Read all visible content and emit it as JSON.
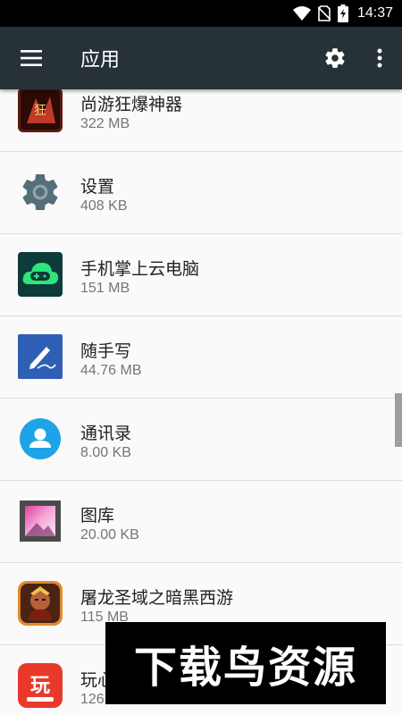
{
  "status_bar": {
    "time": "14:37",
    "icons": [
      "wifi-icon",
      "no-sim-icon",
      "battery-charging-icon"
    ]
  },
  "app_bar": {
    "title": "应用",
    "menu_icon": "hamburger-menu-icon",
    "actions": [
      "settings-gear-icon",
      "overflow-menu-icon"
    ]
  },
  "apps": [
    {
      "name": "尚游狂爆神器",
      "size": "322 MB",
      "icon": "game-artwork-icon"
    },
    {
      "name": "设置",
      "size": "408 KB",
      "icon": "settings-gear-icon"
    },
    {
      "name": "手机掌上云电脑",
      "size": "151 MB",
      "icon": "cloud-gamepad-icon"
    },
    {
      "name": "随手写",
      "size": "44.76 MB",
      "icon": "pen-writing-icon"
    },
    {
      "name": "通讯录",
      "size": "8.00 KB",
      "icon": "contacts-person-icon"
    },
    {
      "name": "图库",
      "size": "20.00 KB",
      "icon": "gallery-picture-icon"
    },
    {
      "name": "屠龙圣域之暗黑西游",
      "size": "115 MB",
      "icon": "warrior-game-icon"
    },
    {
      "name": "玩心",
      "size": "126",
      "icon": "wanxin-logo-icon"
    }
  ],
  "watermark": {
    "text": "下载鸟资源"
  },
  "colors": {
    "app_bar": "#263238",
    "status_bar": "#000000",
    "background": "#fafafa",
    "divider": "#dcdcdc"
  }
}
